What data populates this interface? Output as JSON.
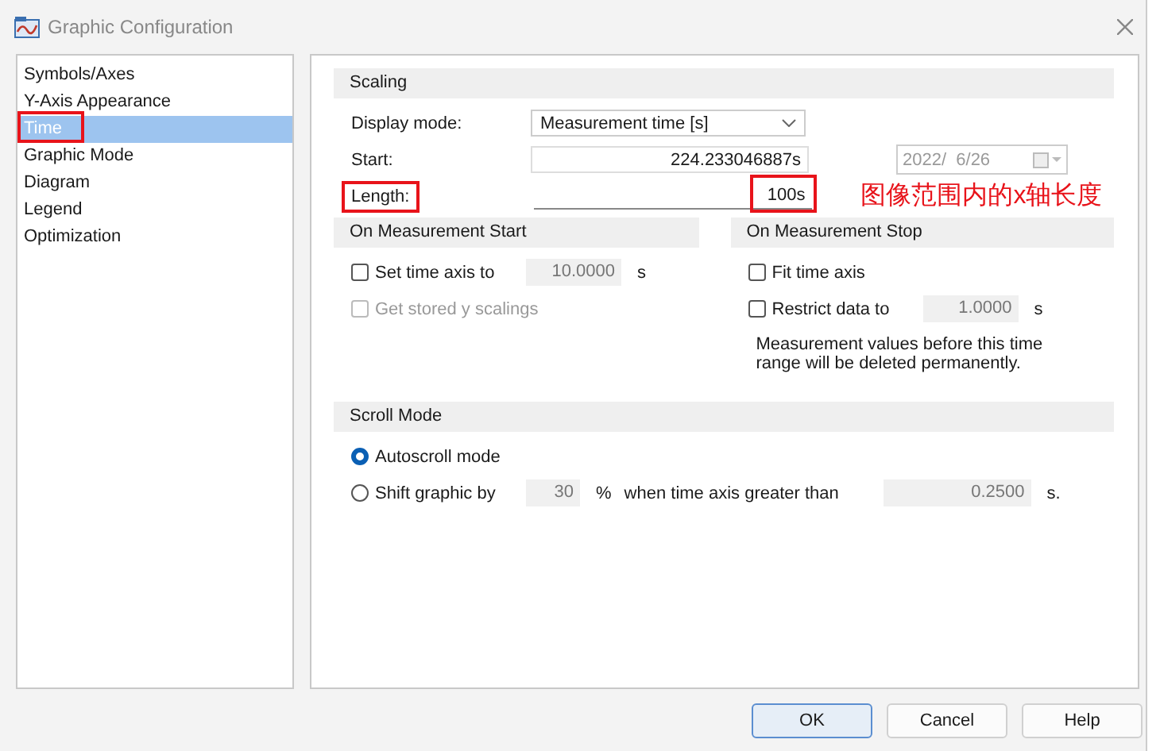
{
  "window": {
    "title": "Graphic Configuration"
  },
  "sidebar": {
    "items": [
      {
        "label": "Symbols/Axes",
        "selected": false,
        "highlighted": false
      },
      {
        "label": "Y-Axis Appearance",
        "selected": false,
        "highlighted": false
      },
      {
        "label": "Time",
        "selected": true,
        "highlighted": true
      },
      {
        "label": "Graphic Mode",
        "selected": false,
        "highlighted": false
      },
      {
        "label": "Diagram",
        "selected": false,
        "highlighted": false
      },
      {
        "label": "Legend",
        "selected": false,
        "highlighted": false
      },
      {
        "label": "Optimization",
        "selected": false,
        "highlighted": false
      }
    ]
  },
  "scaling": {
    "title": "Scaling",
    "display_mode": {
      "label": "Display mode:",
      "value": "Measurement time [s]"
    },
    "start": {
      "label": "Start:",
      "value": "224.233046887s",
      "date": "2022/  6/26"
    },
    "length": {
      "label": "Length:",
      "value": "100s",
      "label_highlighted": true,
      "value_highlighted": true
    },
    "annotation": "图像范围内的x轴长度"
  },
  "measurement_start": {
    "title": "On Measurement Start",
    "options": [
      {
        "label": "Set time axis to",
        "checked": false,
        "disabled": false,
        "value": "10.0000",
        "unit": "s"
      },
      {
        "label": "Get stored y scalings",
        "checked": false,
        "disabled": true
      }
    ]
  },
  "measurement_stop": {
    "title": "On Measurement Stop",
    "options": [
      {
        "label": "Fit time axis",
        "checked": false,
        "disabled": false
      },
      {
        "label": "Restrict data to",
        "checked": false,
        "disabled": false,
        "value": "1.0000",
        "unit": "s"
      }
    ],
    "note": "Measurement values before this time range will be deleted permanently."
  },
  "scroll_mode": {
    "title": "Scroll Mode",
    "options": [
      {
        "label": "Autoscroll mode",
        "selected": true
      },
      {
        "label": "Shift graphic by",
        "selected": false,
        "value": "30",
        "unit": "%",
        "condition": "when time axis greater than",
        "threshold": "0.2500",
        "threshold_unit": "s."
      }
    ]
  },
  "buttons": [
    {
      "label": "OK",
      "default": true
    },
    {
      "label": "Cancel",
      "default": false
    },
    {
      "label": "Help",
      "default": false
    }
  ]
}
